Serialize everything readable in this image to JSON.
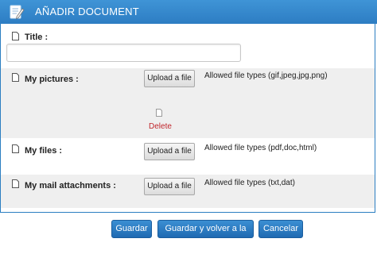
{
  "header": {
    "title": "AÑADIR DOCUMENT"
  },
  "form": {
    "title_label": "Title :",
    "title_value": "",
    "pictures_label": "My pictures :",
    "files_label": "My files :",
    "mail_label": "My mail attachments :",
    "upload_label": "Upload a file",
    "pictures_allowed": "Allowed file types (gif,jpeg,jpg,png)",
    "files_allowed": "Allowed file types (pdf,doc,html)",
    "mail_allowed": "Allowed file types (txt,dat)",
    "delete_label": "Delete"
  },
  "actions": {
    "save": "Guardar",
    "save_back": "Guardar y volver a la lista",
    "cancel": "Cancelar"
  },
  "colors": {
    "header": "#2d7dc3",
    "button": "#2a7cc4",
    "delete": "#c0262c",
    "row_alt": "#efefef"
  }
}
